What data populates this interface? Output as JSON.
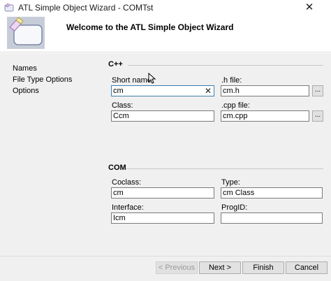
{
  "window": {
    "title": "ATL Simple Object Wizard - COMTst",
    "close_glyph": "✕"
  },
  "banner": {
    "heading": "Welcome to the ATL Simple Object Wizard",
    "logo_icon": "wizard-window-icon"
  },
  "nav": {
    "items": [
      {
        "label": "Names"
      },
      {
        "label": "File Type Options"
      },
      {
        "label": "Options"
      }
    ]
  },
  "cpp": {
    "label": "C++",
    "short_name": {
      "label": "Short name:",
      "value": "cm"
    },
    "h_file": {
      "label": ".h file:",
      "value": "cm.h"
    },
    "class": {
      "label": "Class:",
      "value": "Ccm"
    },
    "cpp_file": {
      "label": ".cpp file:",
      "value": "cm.cpp"
    }
  },
  "com": {
    "label": "COM",
    "coclass": {
      "label": "Coclass:",
      "value": "cm"
    },
    "type": {
      "label": "Type:",
      "value": "cm Class"
    },
    "interface": {
      "label": "Interface:",
      "value": "Icm"
    },
    "progid": {
      "label": "ProgID:",
      "value": ""
    }
  },
  "browse_label": "...",
  "clear_glyph": "✕",
  "buttons": {
    "previous": "< Previous",
    "next": "Next >",
    "finish": "Finish",
    "cancel": "Cancel"
  }
}
